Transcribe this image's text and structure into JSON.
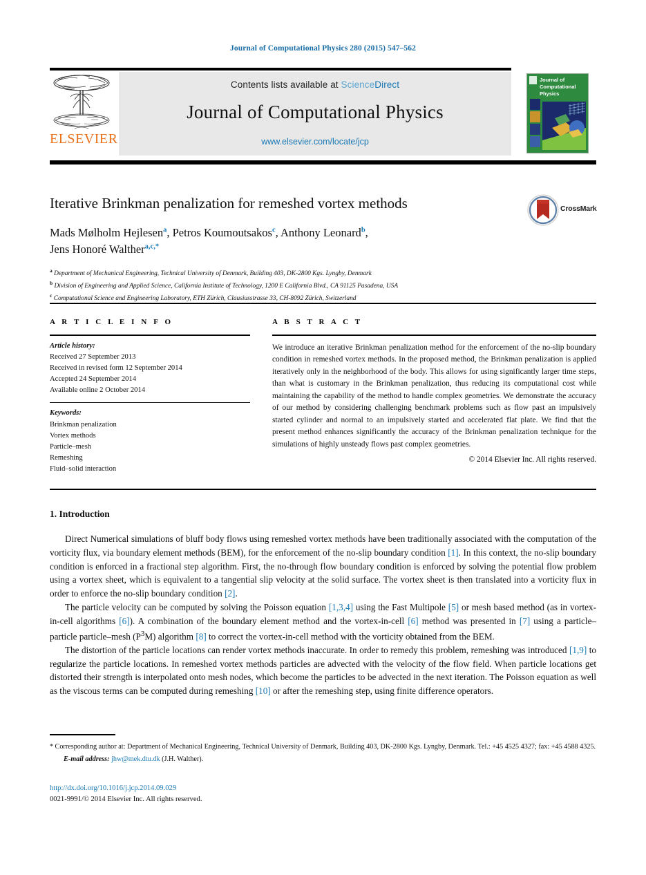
{
  "running_head": "Journal of Computational Physics 280 (2015) 547–562",
  "masthead": {
    "contents_prefix": "Contents lists available at ",
    "sciencedirect_part1": "Science",
    "sciencedirect_part2": "Direct",
    "journal_name": "Journal of Computational Physics",
    "url": "www.elsevier.com/locate/jcp",
    "publisher_wordmark": "ELSEVIER",
    "cover_title_line1": "Journal of",
    "cover_title_line2": "Computational",
    "cover_title_line3": "Physics"
  },
  "article": {
    "title": "Iterative Brinkman penalization for remeshed vortex methods",
    "crossmark_label": "CrossMark",
    "authors_line1_a": "Mads Mølholm Hejlesen",
    "authors_line1_a_mark": "a",
    "authors_line1_b": ", Petros Koumoutsakos",
    "authors_line1_b_mark": "c",
    "authors_line1_c": ", Anthony Leonard",
    "authors_line1_c_mark": "b",
    "authors_line1_d": ",",
    "authors_line2": "Jens Honoré Walther",
    "authors_line2_mark": "a,c,",
    "authors_line2_star": "*",
    "affiliations": [
      {
        "mark": "a",
        "text": "Department of Mechanical Engineering, Technical University of Denmark, Building 403, DK-2800 Kgs. Lyngby, Denmark"
      },
      {
        "mark": "b",
        "text": "Division of Engineering and Applied Science, California Institute of Technology, 1200 E California Blvd., CA 91125 Pasadena, USA"
      },
      {
        "mark": "c",
        "text": "Computational Science and Engineering Laboratory, ETH Zürich, Clausiusstrasse 33, CH-8092 Zürich, Switzerland"
      }
    ]
  },
  "article_info": {
    "heading": "A R T I C L E   I N F O",
    "history_label": "Article history:",
    "history": [
      "Received 27 September 2013",
      "Received in revised form 12 September 2014",
      "Accepted 24 September 2014",
      "Available online 2 October 2014"
    ],
    "keywords_label": "Keywords:",
    "keywords": [
      "Brinkman penalization",
      "Vortex methods",
      "Particle–mesh",
      "Remeshing",
      "Fluid–solid interaction"
    ]
  },
  "abstract": {
    "heading": "A B S T R A C T",
    "text": "We introduce an iterative Brinkman penalization method for the enforcement of the no-slip boundary condition in remeshed vortex methods. In the proposed method, the Brinkman penalization is applied iteratively only in the neighborhood of the body. This allows for using significantly larger time steps, than what is customary in the Brinkman penalization, thus reducing its computational cost while maintaining the capability of the method to handle complex geometries. We demonstrate the accuracy of our method by considering challenging benchmark problems such as flow past an impulsively started cylinder and normal to an impulsively started and accelerated flat plate. We find that the present method enhances significantly the accuracy of the Brinkman penalization technique for the simulations of highly unsteady flows past complex geometries.",
    "copyright": "© 2014 Elsevier Inc. All rights reserved."
  },
  "body": {
    "section_number_title": "1. Introduction",
    "paragraph1_parts": [
      "Direct Numerical simulations of bluff body flows using remeshed vortex methods have been traditionally associated with the computation of the vorticity flux, via boundary element methods (BEM), for the enforcement of the no-slip boundary condition ",
      "[1]",
      ". In this context, the no-slip boundary condition is enforced in a fractional step algorithm. First, the no-through flow boundary condition is enforced by solving the potential flow problem using a vortex sheet, which is equivalent to a tangential slip velocity at the solid surface. The vortex sheet is then translated into a vorticity flux in order to enforce the no-slip boundary condition ",
      "[2]",
      "."
    ],
    "paragraph2_parts": [
      "The particle velocity can be computed by solving the Poisson equation ",
      "[1,3,4]",
      " using the Fast Multipole ",
      "[5]",
      " or mesh based method (as in vortex-in-cell algorithms ",
      "[6]",
      "). A combination of the boundary element method and the vortex-in-cell ",
      "[6]",
      " method was presented in ",
      "[7]",
      " using a particle–particle particle–mesh (P",
      "3",
      "M) algorithm ",
      "[8]",
      " to correct the vortex-in-cell method with the vorticity obtained from the BEM."
    ],
    "paragraph3_parts": [
      "The distortion of the particle locations can render vortex methods inaccurate. In order to remedy this problem, remeshing was introduced ",
      "[1,9]",
      " to regularize the particle locations. In remeshed vortex methods particles are advected with the velocity of the flow field. When particle locations get distorted their strength is interpolated onto mesh nodes, which become the particles to be advected in the next iteration. The Poisson equation as well as the viscous terms can be computed during remeshing ",
      "[10]",
      " or after the remeshing step, using finite difference operators."
    ]
  },
  "footnote": {
    "star": "*",
    "corresponding": "Corresponding author at: Department of Mechanical Engineering, Technical University of Denmark, Building 403, DK-2800 Kgs. Lyngby, Denmark. Tel.: +45 4525 4327; fax: +45 4588 4325.",
    "email_label": "E-mail address:",
    "email": "jhw@mek.dtu.dk",
    "email_owner": "(J.H. Walther)."
  },
  "bottom": {
    "doi": "http://dx.doi.org/10.1016/j.jcp.2014.09.029",
    "issn_line": "0021-9991/© 2014 Elsevier Inc. All rights reserved."
  },
  "colors": {
    "link_blue": "#1a79b5",
    "head_blue": "#1a6ea8",
    "elsevier_orange": "#e9711c",
    "cover_green": "#2d8a3e",
    "masthead_grey": "#e8e8e8"
  }
}
